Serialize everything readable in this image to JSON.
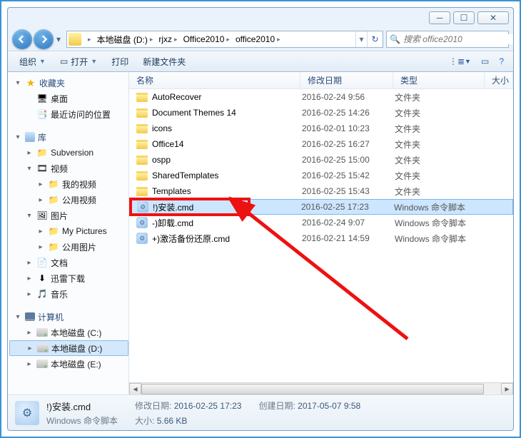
{
  "address": {
    "segments": [
      "本地磁盘 (D:)",
      "rjxz",
      "Office2010",
      "office2010"
    ]
  },
  "search": {
    "placeholder": "搜索 office2010"
  },
  "toolbar": {
    "organize": "组织",
    "open": "打开",
    "print": "打印",
    "newfolder": "新建文件夹"
  },
  "columns": {
    "name": "名称",
    "date": "修改日期",
    "type": "类型",
    "size": "大小"
  },
  "types": {
    "folder": "文件夹",
    "cmd": "Windows 命令脚本"
  },
  "rows": [
    {
      "name": "AutoRecover",
      "date": "2016-02-24 9:56",
      "type": "folder"
    },
    {
      "name": "Document Themes 14",
      "date": "2016-02-25 14:26",
      "type": "folder"
    },
    {
      "name": "icons",
      "date": "2016-02-01 10:23",
      "type": "folder"
    },
    {
      "name": "Office14",
      "date": "2016-02-25 16:27",
      "type": "folder"
    },
    {
      "name": "ospp",
      "date": "2016-02-25 15:00",
      "type": "folder"
    },
    {
      "name": "SharedTemplates",
      "date": "2016-02-25 15:42",
      "type": "folder"
    },
    {
      "name": "Templates",
      "date": "2016-02-25 15:43",
      "type": "folder"
    },
    {
      "name": "!)安装.cmd",
      "date": "2016-02-25 17:23",
      "type": "cmd",
      "selected": true
    },
    {
      "name": "-)卸载.cmd",
      "date": "2016-02-24 9:07",
      "type": "cmd"
    },
    {
      "name": "+)激活备份还原.cmd",
      "date": "2016-02-21 14:59",
      "type": "cmd"
    }
  ],
  "sidebar": {
    "fav": "收藏夹",
    "desktop": "桌面",
    "recent": "最近访问的位置",
    "lib": "库",
    "subversion": "Subversion",
    "video": "视频",
    "myvideo": "我的视频",
    "pubvideo": "公用视频",
    "pic": "图片",
    "mypic": "My Pictures",
    "pubpic": "公用图片",
    "doc": "文档",
    "xunlei": "迅雷下载",
    "music": "音乐",
    "computer": "计算机",
    "driveC": "本地磁盘 (C:)",
    "driveD": "本地磁盘 (D:)",
    "driveE": "本地磁盘 (E:)"
  },
  "details": {
    "filename": "!)安装.cmd",
    "filetype": "Windows 命令脚本",
    "modlabel": "修改日期:",
    "modval": "2016-02-25 17:23",
    "sizelabel": "大小:",
    "sizeval": "5.66 KB",
    "createlabel": "创建日期:",
    "createval": "2017-05-07 9:58"
  }
}
